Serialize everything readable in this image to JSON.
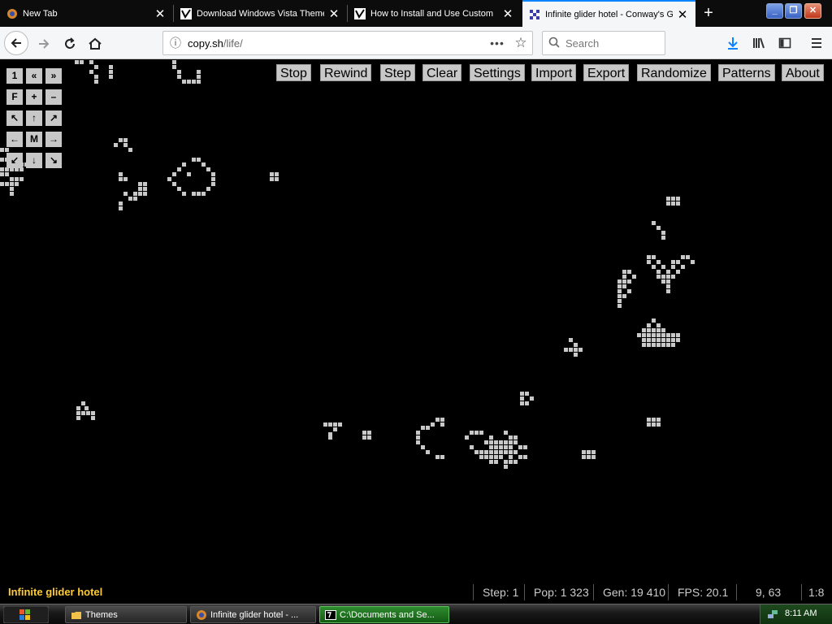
{
  "browser": {
    "tabs": [
      {
        "label": "New Tab",
        "close": "✕"
      },
      {
        "label": "Download Windows Vista Theme",
        "close": "✕"
      },
      {
        "label": "How to Install and Use Custom",
        "close": "✕"
      },
      {
        "label": "Infinite glider hotel - Conway's Game of Life",
        "close": "✕"
      }
    ],
    "new_tab": "+",
    "url_domain": "copy.sh",
    "url_path": "/life/",
    "search_placeholder": "Search",
    "window_buttons": {
      "minimize": "_",
      "restore": "❐",
      "close": "✕"
    }
  },
  "life": {
    "toolbar": [
      "Stop",
      "Rewind",
      "Step",
      "Clear",
      "Settings",
      "Import",
      "Export",
      "Randomize",
      "Patterns",
      "About"
    ],
    "zoom_buttons": [
      "1",
      "«",
      "»",
      "F",
      "+",
      "–",
      "↖",
      "↑",
      "↗",
      "←",
      "M",
      "→",
      "↙",
      "↓",
      "↘"
    ],
    "pattern_name": "Infinite glider hotel",
    "status": {
      "step": "Step: 1",
      "pop": "Pop: 1 323",
      "gen": "Gen: 19 410",
      "fps": "FPS: 20.1",
      "coords": "9, 63",
      "zoom": "1:8"
    },
    "cell_color": "#c8c8c8",
    "background_color": "#000000"
  },
  "taskbar": {
    "items": [
      {
        "label": "Themes"
      },
      {
        "label": "Infinite glider hotel - ..."
      },
      {
        "label": "C:\\Documents and Se..."
      }
    ],
    "clock": "8:11 AM"
  }
}
